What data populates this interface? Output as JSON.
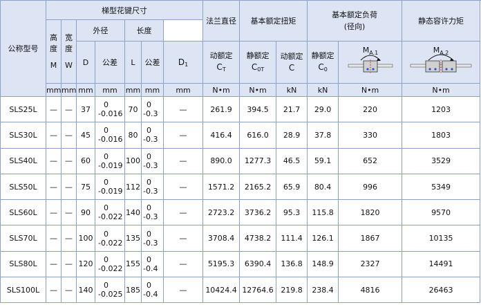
{
  "headers": {
    "model": "公称型号",
    "spline_size": "梯型花键尺寸",
    "height": "高度",
    "height_sym": "M",
    "width": "宽度",
    "width_sym": "W",
    "outer_diameter": "外径",
    "length": "长度",
    "flange_diameter": "法兰直径",
    "rated_torque": "基本额定扭矩",
    "rated_load_line1": "基本额定负荷",
    "rated_load_line2": "(径向)",
    "static_moment": "静态容许力矩",
    "D": "D",
    "tolerance": "公差",
    "L": "L",
    "D1": "D",
    "D1_sub": "1",
    "dynamic_torque_l1": "动额定",
    "dynamic_torque_sym": "C",
    "dynamic_torque_sub": "T",
    "static_torque_l1": "静额定",
    "static_torque_sym": "C",
    "static_torque_sub": "0T",
    "dynamic_load_l1": "动额定",
    "dynamic_load_sym": "C",
    "static_load_l1": "静额定",
    "static_load_sym": "C",
    "static_load_sub": "0",
    "ma1_sym": "M",
    "ma1_sub": "A.1",
    "ma2_sym": "M",
    "ma2_sub": "A.2"
  },
  "units": [
    "mm",
    "mm",
    "mm",
    "mm",
    "mm",
    "mm",
    "mm",
    "N•m",
    "N•m",
    "kN",
    "kN",
    "N•m",
    "N•m"
  ],
  "rows": [
    {
      "model": "SLS25L",
      "M": "—",
      "W": "—",
      "D": "37",
      "D_tol_upper": "0",
      "D_tol_lower": "-0.016",
      "L": "70",
      "L_tol_upper": "0",
      "L_tol_lower": "-0.3",
      "D1": "—",
      "CT": "261.9",
      "C0T": "394.5",
      "C": "21.7",
      "C0": "29.0",
      "MA1": "220",
      "MA2": "1203"
    },
    {
      "model": "SLS30L",
      "M": "—",
      "W": "—",
      "D": "45",
      "D_tol_upper": "0",
      "D_tol_lower": "-0.016",
      "L": "80",
      "L_tol_upper": "0",
      "L_tol_lower": "-0.3",
      "D1": "—",
      "CT": "416.4",
      "C0T": "616.0",
      "C": "28.9",
      "C0": "37.8",
      "MA1": "330",
      "MA2": "1803"
    },
    {
      "model": "SLS40L",
      "M": "—",
      "W": "—",
      "D": "60",
      "D_tol_upper": "0",
      "D_tol_lower": "-0.019",
      "L": "100",
      "L_tol_upper": "0",
      "L_tol_lower": "-0.3",
      "D1": "—",
      "CT": "890.0",
      "C0T": "1277.3",
      "C": "46.5",
      "C0": "59.1",
      "MA1": "652",
      "MA2": "3529"
    },
    {
      "model": "SLS50L",
      "M": "—",
      "W": "—",
      "D": "75",
      "D_tol_upper": "0",
      "D_tol_lower": "-0.019",
      "L": "112",
      "L_tol_upper": "0",
      "L_tol_lower": "-0.3",
      "D1": "—",
      "CT": "1571.2",
      "C0T": "2165.2",
      "C": "65.9",
      "C0": "80.4",
      "MA1": "996",
      "MA2": "5349"
    },
    {
      "model": "SLS60L",
      "M": "—",
      "W": "—",
      "D": "90",
      "D_tol_upper": "0",
      "D_tol_lower": "-0.022",
      "L": "140",
      "L_tol_upper": "0",
      "L_tol_lower": "-0.3",
      "D1": "—",
      "CT": "2723.2",
      "C0T": "3736.2",
      "C": "95.3",
      "C0": "115.8",
      "MA1": "1820",
      "MA2": "9570"
    },
    {
      "model": "SLS70L",
      "M": "—",
      "W": "—",
      "D": "100",
      "D_tol_upper": "0",
      "D_tol_lower": "-0.022",
      "L": "135",
      "L_tol_upper": "0",
      "L_tol_lower": "-0.3",
      "D1": "—",
      "CT": "3708.4",
      "C0T": "4738.2",
      "C": "111.4",
      "C0": "126.1",
      "MA1": "1867",
      "MA2": "10135"
    },
    {
      "model": "SLS80L",
      "M": "—",
      "W": "—",
      "D": "120",
      "D_tol_upper": "0",
      "D_tol_lower": "-0.022",
      "L": "155",
      "L_tol_upper": "0",
      "L_tol_lower": "-0.4",
      "D1": "—",
      "CT": "5195.3",
      "C0T": "6390.4",
      "C": "136.8",
      "C0": "148.9",
      "MA1": "2327",
      "MA2": "14491"
    },
    {
      "model": "SLS100L",
      "M": "—",
      "W": "—",
      "D": "140",
      "D_tol_upper": "0",
      "D_tol_lower": "-0.025",
      "L": "185",
      "L_tol_upper": "0",
      "L_tol_lower": "-0.4",
      "D1": "—",
      "CT": "10424.4",
      "C0T": "12764.6",
      "C": "219.8",
      "C0": "238.4",
      "MA1": "4816",
      "MA2": "26463"
    }
  ],
  "colors": {
    "header_bg": "#dde4f4",
    "border": "#8aa0c8",
    "icon_red": "#d02020",
    "icon_blue": "#2a55c8"
  },
  "icons": [
    "moment-ma1-icon",
    "moment-ma2-icon"
  ]
}
